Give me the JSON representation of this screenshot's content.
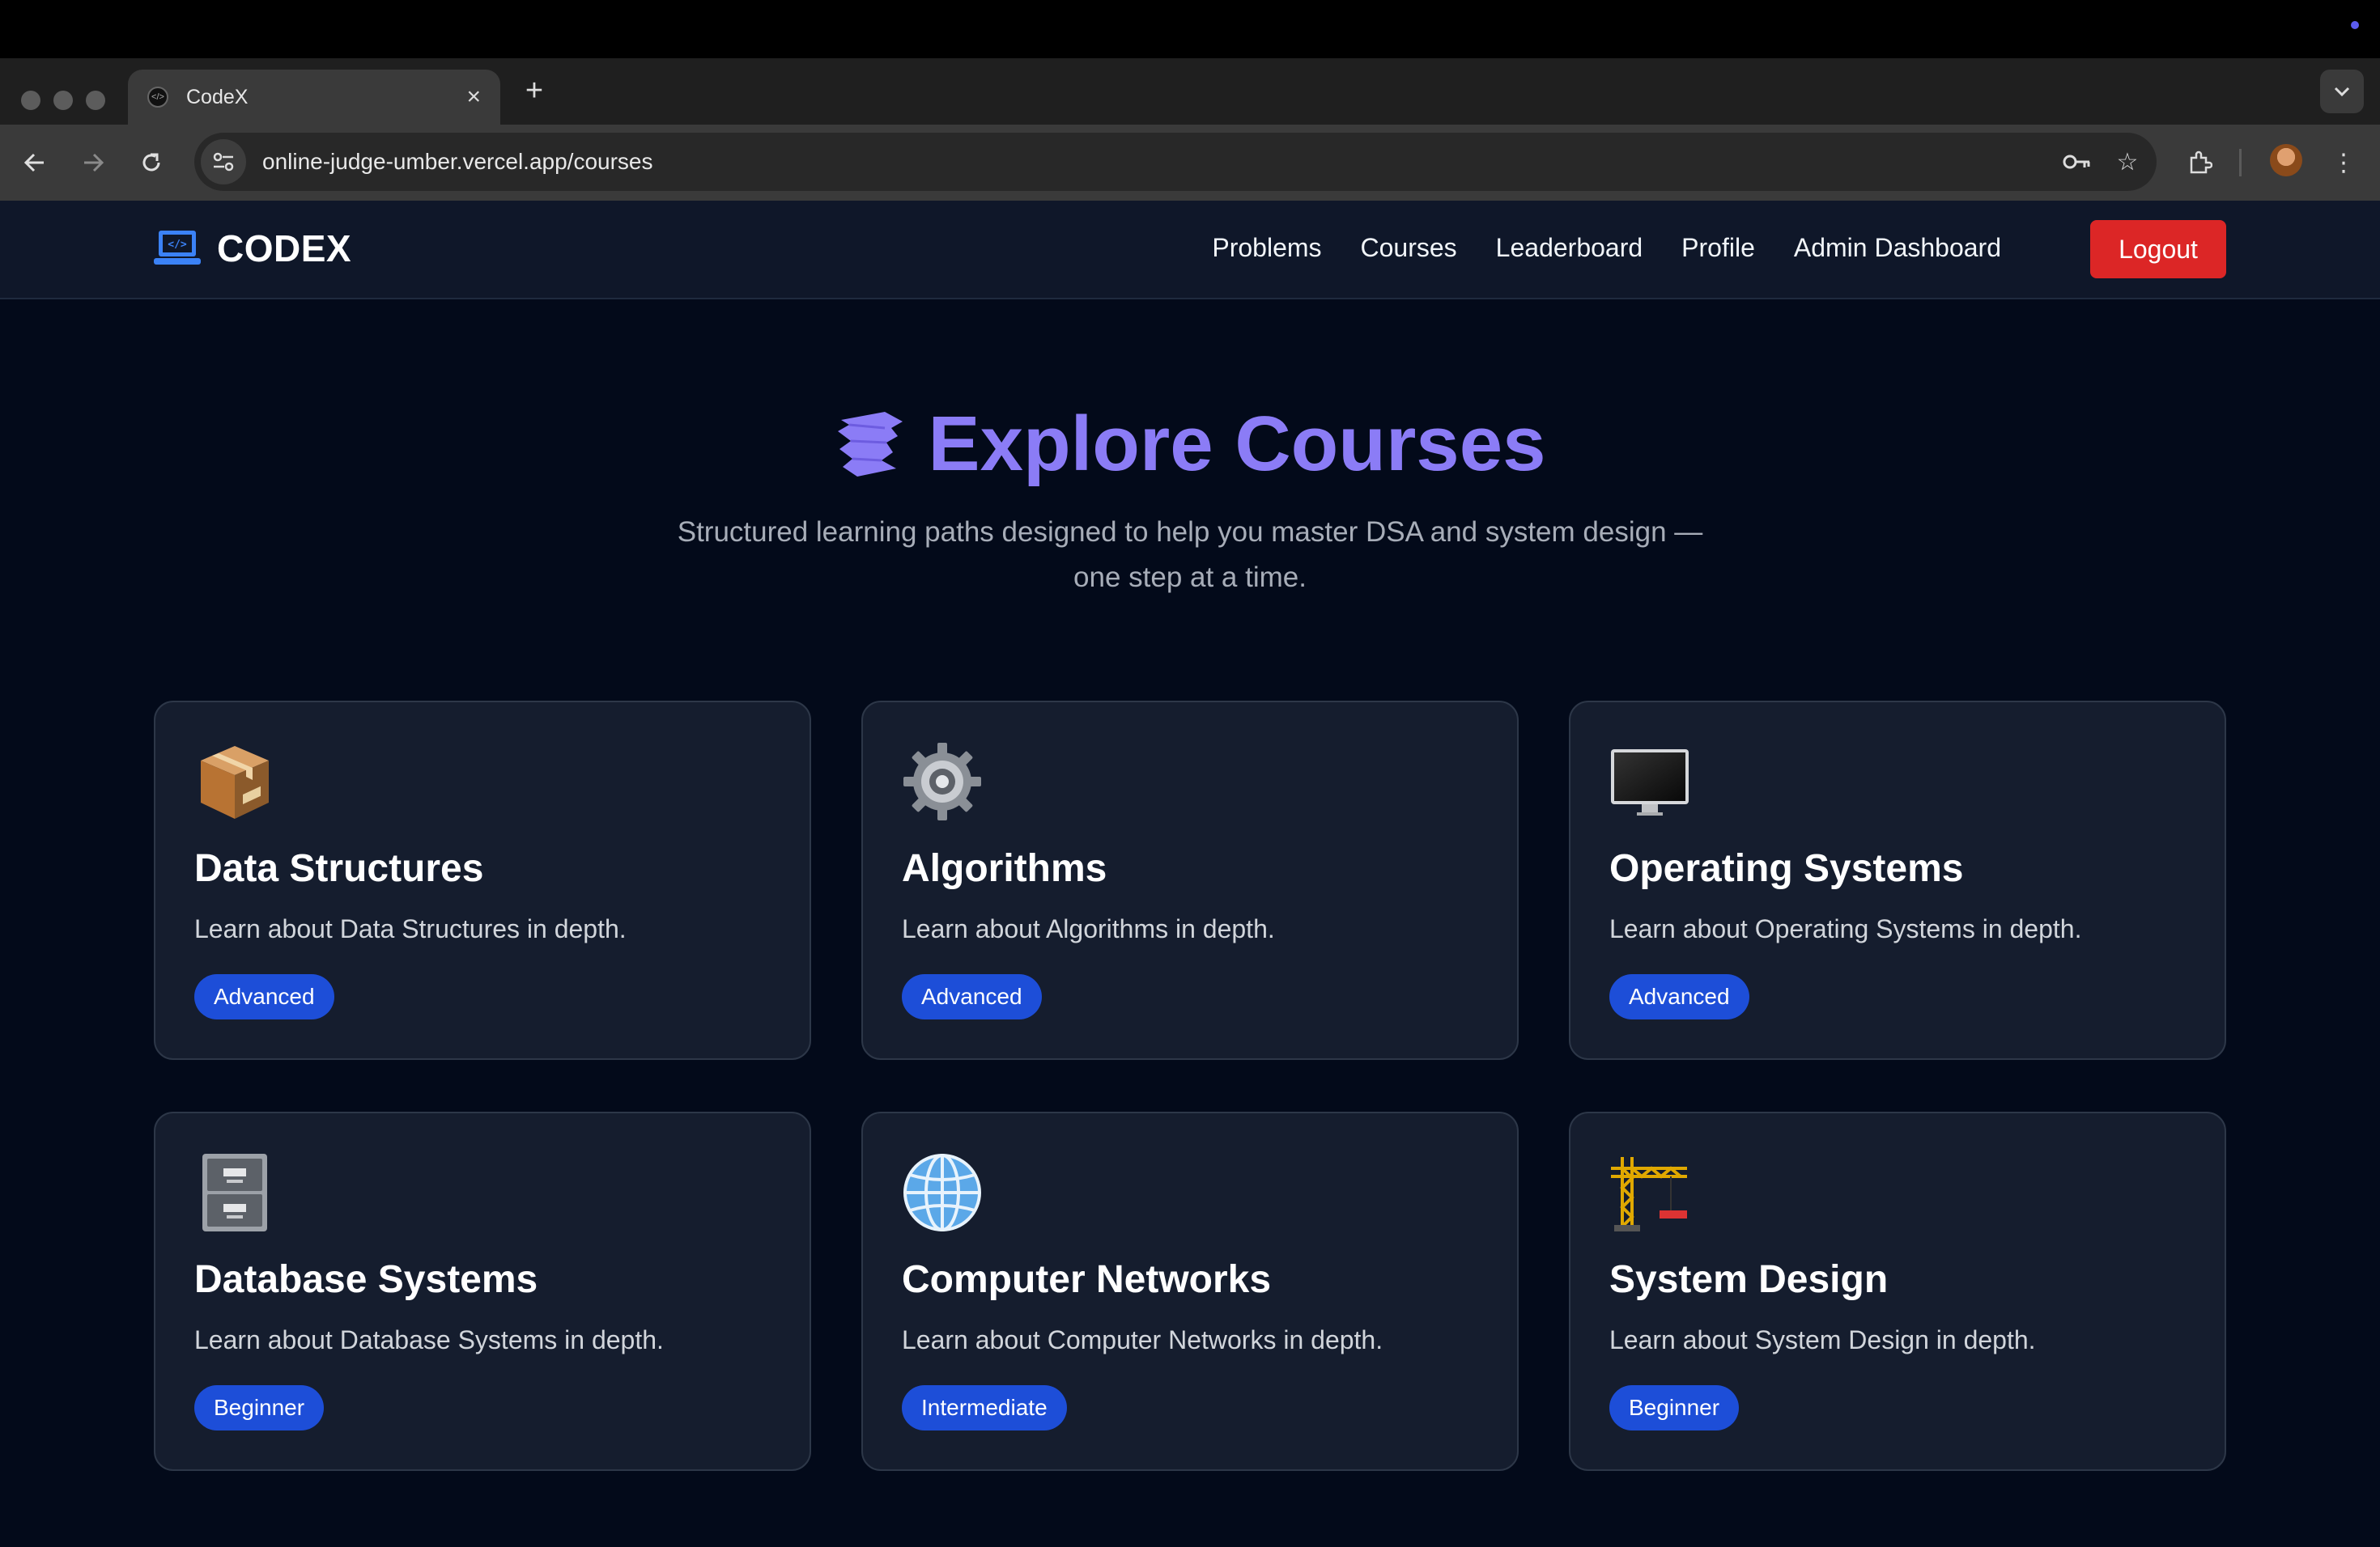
{
  "browser": {
    "tab_title": "CodeX",
    "url": "online-judge-umber.vercel.app/courses"
  },
  "site": {
    "brand": "CODEX",
    "nav": [
      "Problems",
      "Courses",
      "Leaderboard",
      "Profile",
      "Admin Dashboard"
    ],
    "logout_label": "Logout",
    "accent_color": "#8b7cf6",
    "logout_color": "#dc2626",
    "badge_color": "#1d4ed8"
  },
  "hero": {
    "title": "Explore Courses",
    "subtitle_line1": "Structured learning paths designed to help you master DSA and system design —",
    "subtitle_line2": "one step at a time."
  },
  "courses": [
    {
      "icon": "package-icon",
      "title": "Data Structures",
      "description": "Learn about Data Structures in depth.",
      "level": "Advanced"
    },
    {
      "icon": "gear-icon",
      "title": "Algorithms",
      "description": "Learn about Algorithms in depth.",
      "level": "Advanced"
    },
    {
      "icon": "desktop-computer-icon",
      "title": "Operating Systems",
      "description": "Learn about Operating Systems in depth.",
      "level": "Advanced"
    },
    {
      "icon": "file-cabinet-icon",
      "title": "Database Systems",
      "description": "Learn about Database Systems in depth.",
      "level": "Beginner"
    },
    {
      "icon": "globe-icon",
      "title": "Computer Networks",
      "description": "Learn about Computer Networks in depth.",
      "level": "Intermediate"
    },
    {
      "icon": "construction-crane-icon",
      "title": "System Design",
      "description": "Learn about System Design in depth.",
      "level": "Beginner"
    }
  ]
}
